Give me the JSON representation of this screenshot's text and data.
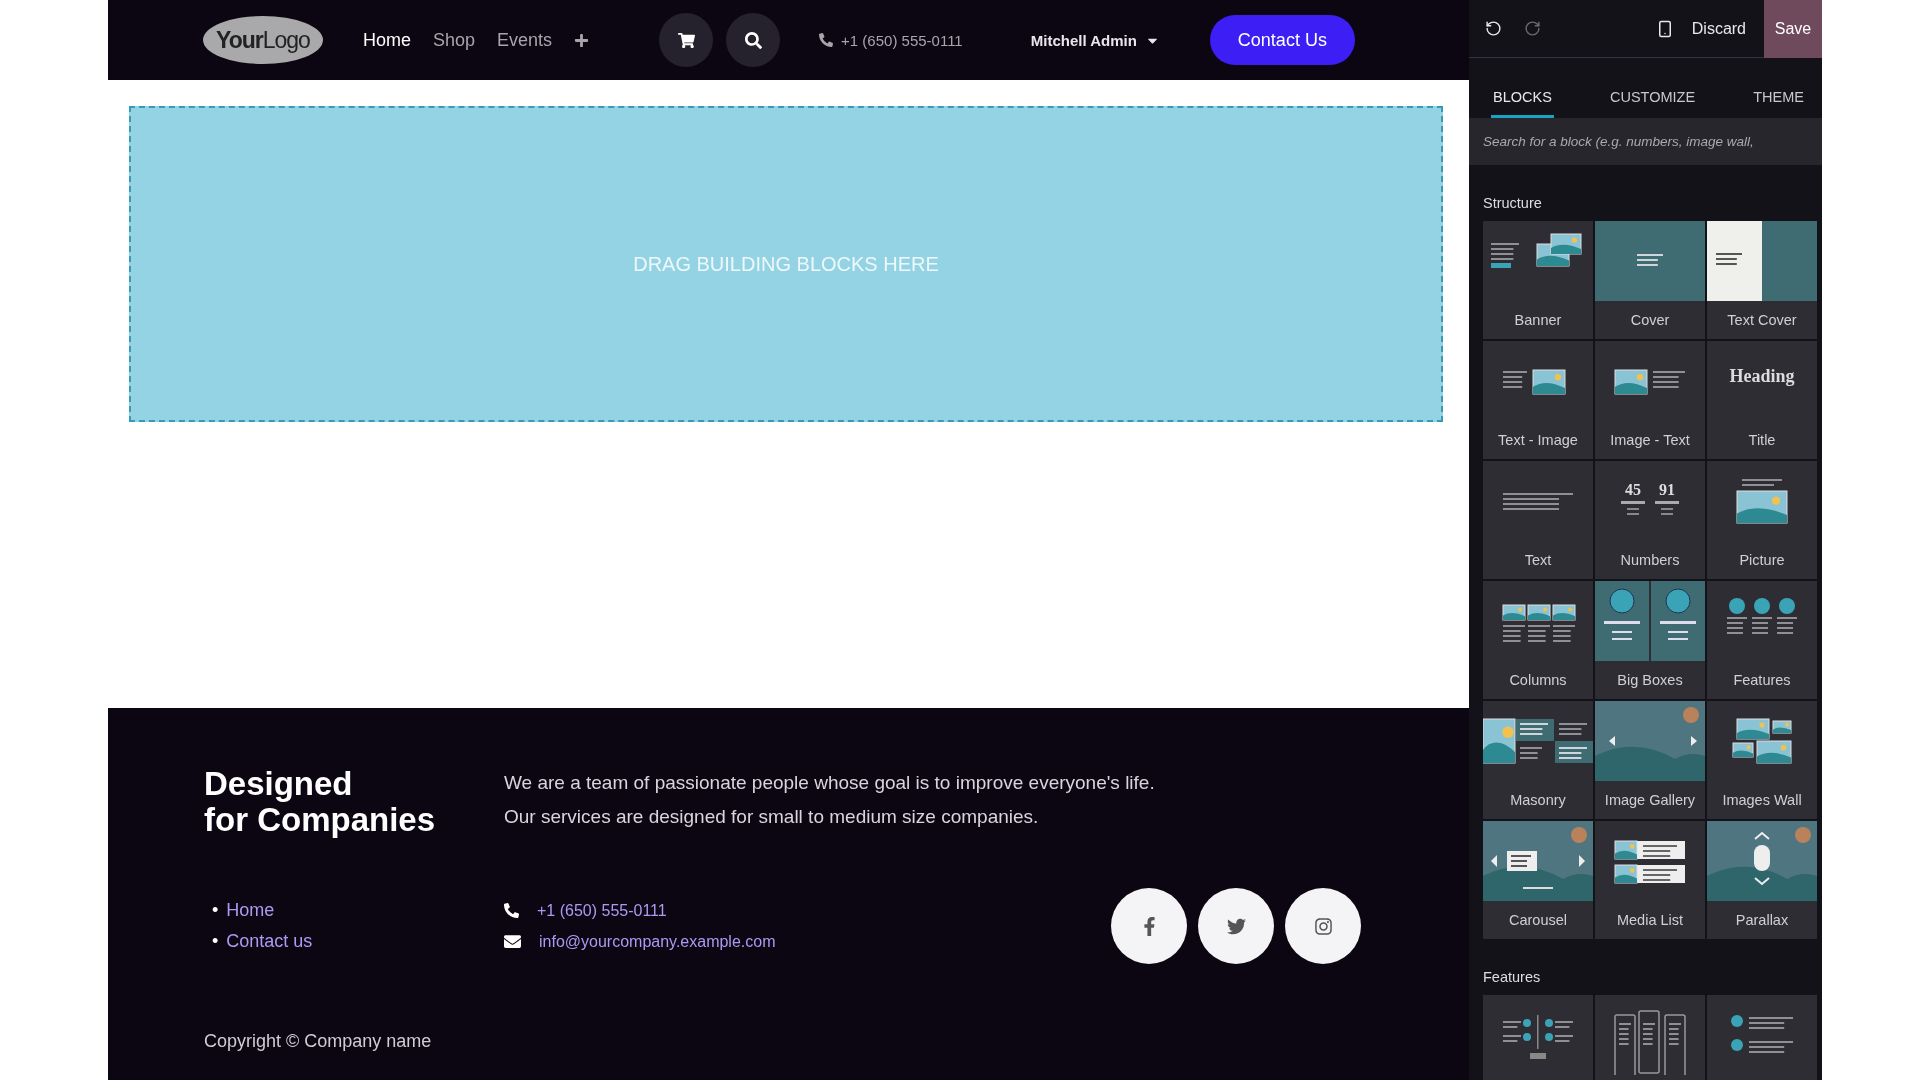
{
  "nav": {
    "logo": "**Your**Logo",
    "links": [
      {
        "label": "Home",
        "selected": true
      },
      {
        "label": "Shop",
        "selected": false
      },
      {
        "label": "Events",
        "selected": false
      }
    ],
    "phone": "+1 (650) 555-0111",
    "user": "Mitchell Admin",
    "contact_button": "Contact Us"
  },
  "drop_zone": {
    "text": "DRAG BUILDING BLOCKS HERE"
  },
  "footer": {
    "title_lines": [
      "Designed",
      "for Companies"
    ],
    "description_lines": [
      "We are a team of passionate people whose goal is to improve everyone's life.",
      "Our services are designed for small to medium size companies."
    ],
    "links": [
      {
        "bullet": "•",
        "label": "Home"
      },
      {
        "bullet": "•",
        "label": "Contact us"
      }
    ],
    "phone": "+1 (650) 555-0111",
    "email": "info@yourcompany.example.com",
    "copyright": "Copyright © Company name"
  },
  "editor": {
    "history": [
      {
        "kind": "undo",
        "disabled": false
      },
      {
        "kind": "redo",
        "disabled": true
      }
    ],
    "discard": "Discard",
    "save": "Save",
    "tabs": [
      {
        "label": "BLOCKS",
        "selected": true
      },
      {
        "label": "CUSTOMIZE",
        "selected": false
      },
      {
        "label": "THEME",
        "selected": false
      }
    ],
    "search": {
      "placeholder": "Search for a block (e.g. numbers, image wall,"
    },
    "sections": [
      {
        "title": "Structure",
        "blocks": [
          {
            "kind": "banner",
            "label": "Banner"
          },
          {
            "kind": "cover",
            "label": "Cover"
          },
          {
            "kind": "text_cover",
            "label": "Text Cover"
          },
          {
            "kind": "text_image",
            "label": "Text - Image"
          },
          {
            "kind": "image_text",
            "label": "Image - Text"
          },
          {
            "kind": "title",
            "label": "Title",
            "thumb_texts": [
              "Heading"
            ]
          },
          {
            "kind": "text",
            "label": "Text"
          },
          {
            "kind": "numbers",
            "label": "Numbers",
            "thumb_texts": [
              "45",
              "91"
            ]
          },
          {
            "kind": "picture",
            "label": "Picture"
          },
          {
            "kind": "columns",
            "label": "Columns"
          },
          {
            "kind": "big_boxes",
            "label": "Big Boxes"
          },
          {
            "kind": "features",
            "label": "Features"
          },
          {
            "kind": "masonry",
            "label": "Masonry"
          },
          {
            "kind": "image_gallery",
            "label": "Image Gallery"
          },
          {
            "kind": "images_wall",
            "label": "Images Wall"
          },
          {
            "kind": "carousel",
            "label": "Carousel"
          },
          {
            "kind": "media_list",
            "label": "Media List"
          },
          {
            "kind": "parallax",
            "label": "Parallax"
          }
        ]
      },
      {
        "title": "Features",
        "blocks": [
          {
            "kind": "features_grid"
          },
          {
            "kind": "comparisons"
          },
          {
            "kind": "dot_list"
          }
        ]
      }
    ]
  }
}
